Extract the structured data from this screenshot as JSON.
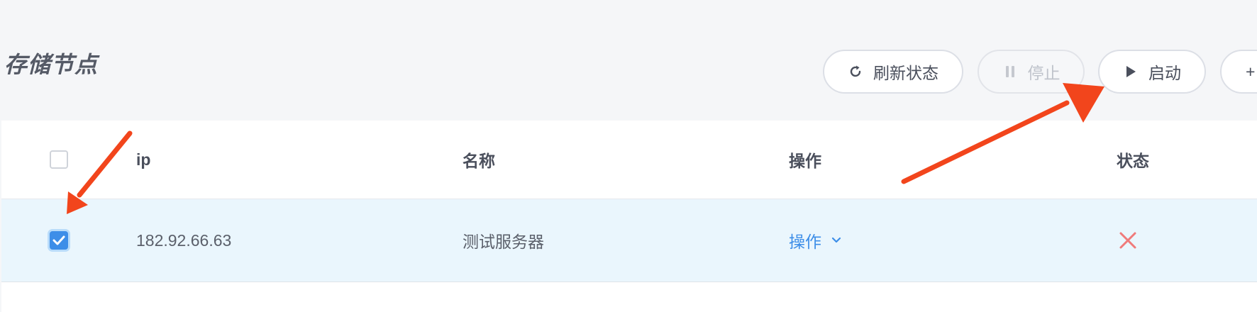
{
  "page": {
    "title": "存储节点"
  },
  "toolbar": {
    "refresh_label": "刷新状态",
    "stop_label": "停止",
    "start_label": "启动",
    "add_label": "+"
  },
  "table": {
    "columns": [
      "ip",
      "名称",
      "操作",
      "状态"
    ],
    "rows": [
      {
        "ip": "182.92.66.63",
        "name": "测试服务器",
        "action_label": "操作",
        "selected": true,
        "status": "error"
      }
    ]
  },
  "icons": {
    "refresh": "refresh-icon",
    "pause": "pause-icon",
    "play": "play-icon",
    "chevron": "chevron-down-icon",
    "status": "close-icon",
    "check": "check-icon"
  },
  "colors": {
    "accent": "#3d8ee8",
    "selected_row": "#eaf6fd",
    "status_error": "#f07a7a",
    "annotation_arrow": "#f2451c"
  }
}
